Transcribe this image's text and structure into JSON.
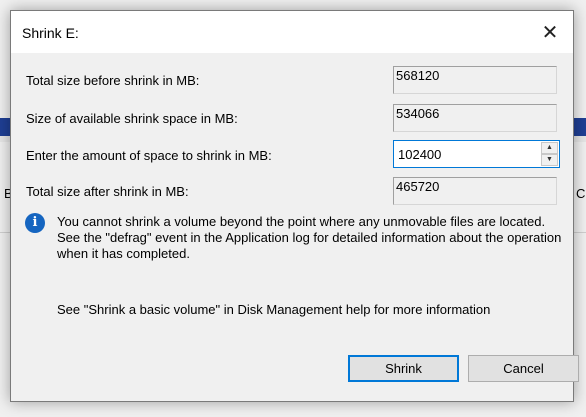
{
  "background": {
    "left_char": "B",
    "right_char": "C"
  },
  "dialog": {
    "title": "Shrink E:",
    "close_glyph": "✕",
    "rows": [
      {
        "label": "Total size before shrink in MB:",
        "value": "568120"
      },
      {
        "label": "Size of available shrink space in MB:",
        "value": "534066"
      },
      {
        "label": "Enter the amount of space to shrink in MB:",
        "value": "102400"
      },
      {
        "label": "Total size after shrink in MB:",
        "value": "465720"
      }
    ],
    "spin_up_glyph": "▲",
    "spin_down_glyph": "▼",
    "info_icon_glyph": "i",
    "info_text": "You cannot shrink a volume beyond the point where any unmovable files are located. See the \"defrag\" event in the Application log for detailed information about the operation when it has completed.",
    "help_text": "See \"Shrink a basic volume\" in Disk Management help for more information",
    "buttons": {
      "shrink": "Shrink",
      "cancel": "Cancel"
    }
  }
}
